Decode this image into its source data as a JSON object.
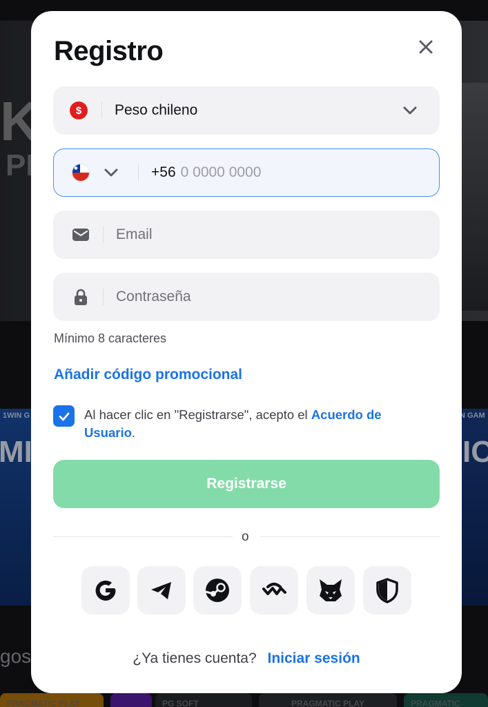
{
  "background": {
    "banner_text": "KY",
    "banner_sub": "PL",
    "tile_left_label": "1WIN G",
    "tile_left_big": "MIN",
    "tile_right_label": "N GAM",
    "tile_right_big": "IC",
    "section_text": "gos",
    "bottom_chips": [
      "PRAGMATIC PLAY",
      "PG SOFT",
      "PRAGMATIC PLAY",
      "PRAGMATIC"
    ]
  },
  "modal": {
    "title": "Registro",
    "close_icon": "close-icon"
  },
  "currency": {
    "icon": "dollar-coin-icon",
    "symbol": "$",
    "value": "Peso chileno"
  },
  "phone": {
    "flag": "chile-flag",
    "prefix": "+56",
    "placeholder": "0 0000 0000"
  },
  "email": {
    "icon": "envelope-icon",
    "placeholder": "Email"
  },
  "password": {
    "icon": "lock-icon",
    "placeholder": "Contraseña",
    "hint": "Mínimo 8 caracteres"
  },
  "promo_link": "Añadir código promocional",
  "terms": {
    "checked": true,
    "text": "Al hacer clic en \"Registrarse\", acepto el",
    "link": "Acuerdo de Usuario",
    "end": "."
  },
  "register_button": "Registrarse",
  "divider_text": "o",
  "social": [
    "google-icon",
    "telegram-icon",
    "steam-icon",
    "walletconnect-icon",
    "metamask-icon",
    "shield-icon"
  ],
  "footer": {
    "question": "¿Ya tienes cuenta?",
    "login_link": "Iniciar sesión"
  },
  "colors": {
    "accent": "#1a73e8",
    "register_disabled": "#83dba9",
    "field_bg": "#f2f2f4"
  }
}
